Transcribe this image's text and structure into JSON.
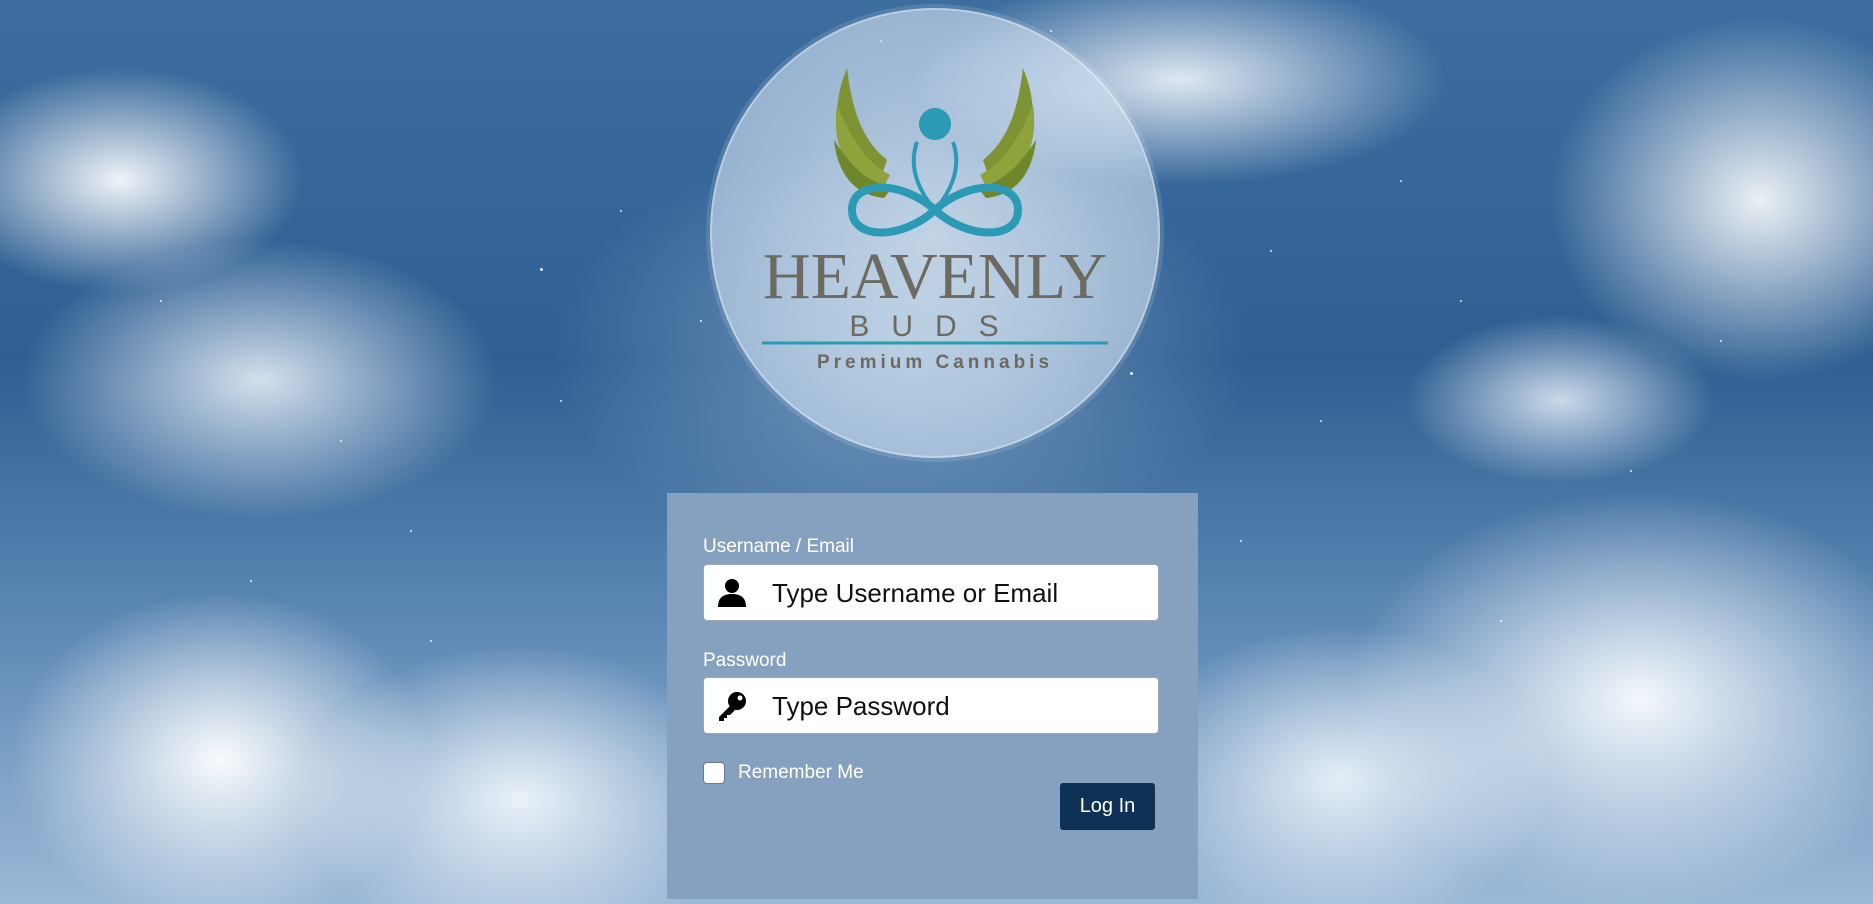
{
  "brand": {
    "name": "HEAVENLY",
    "sub": "BUDS",
    "tagline": "Premium Cannabis",
    "colors": {
      "leaf": "#7e9434",
      "teal": "#2b9bb5",
      "text": "#6d6a62"
    }
  },
  "form": {
    "username_label": "Username / Email",
    "username_placeholder": "Type Username or Email",
    "username_icon": "user-icon",
    "password_label": "Password",
    "password_placeholder": "Type Password",
    "password_icon": "key-icon",
    "remember_label": "Remember Me",
    "remember_checked": false,
    "login_label": "Log In"
  },
  "colors": {
    "panel": "#86a1bf",
    "button": "#0f3155"
  }
}
